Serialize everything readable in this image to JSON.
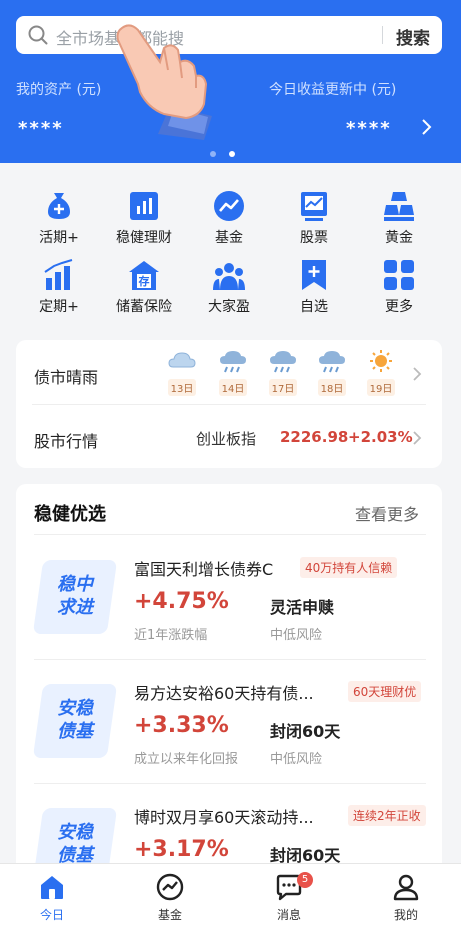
{
  "search": {
    "placeholder": "全市场基金都能搜",
    "button": "搜索"
  },
  "assets": {
    "my_assets_label": "我的资产 (元)",
    "my_assets_value": "****",
    "today_label": "今日收益更新中 (元)",
    "today_value": "****"
  },
  "grid": [
    {
      "label": "活期+",
      "icon": "money-bag-icon"
    },
    {
      "label": "稳健理财",
      "icon": "bar-chart-icon"
    },
    {
      "label": "基金",
      "icon": "trend-circle-icon"
    },
    {
      "label": "股票",
      "icon": "stock-board-icon"
    },
    {
      "label": "黄金",
      "icon": "gold-bars-icon"
    },
    {
      "label": "定期+",
      "icon": "growth-bars-icon"
    },
    {
      "label": "储蓄保险",
      "icon": "savings-house-icon"
    },
    {
      "label": "大家盈",
      "icon": "people-icon"
    },
    {
      "label": "自选",
      "icon": "bookmark-plus-icon"
    },
    {
      "label": "更多",
      "icon": "apps-icon"
    }
  ],
  "market": {
    "bond_title": "债市晴雨",
    "weather": [
      {
        "day": "13日",
        "icon": "cloud-icon"
      },
      {
        "day": "14日",
        "icon": "rain-icon"
      },
      {
        "day": "17日",
        "icon": "rain-icon"
      },
      {
        "day": "18日",
        "icon": "rain-icon"
      },
      {
        "day": "19日",
        "icon": "sun-icon"
      }
    ],
    "stock_title": "股市行情",
    "index_name": "创业板指",
    "index_value": "2226.98",
    "index_change": "+2.03%"
  },
  "products": {
    "title": "稳健优选",
    "more": "查看更多",
    "items": [
      {
        "badge1": "稳中",
        "badge2": "求进",
        "name": "富国天利增长债券C",
        "tag": "40万持有人信赖",
        "rate": "+4.75%",
        "rate_label": "近1年涨跌幅",
        "term": "灵活申赎",
        "risk": "中低风险"
      },
      {
        "badge1": "安稳",
        "badge2": "债基",
        "name": "易方达安裕60天持有债...",
        "tag": "60天理财优",
        "rate": "+3.33%",
        "rate_label": "成立以来年化回报",
        "term": "封闭60天",
        "risk": "中低风险"
      },
      {
        "badge1": "安稳",
        "badge2": "债基",
        "name": "博时双月享60天滚动持...",
        "tag": "连续2年正收",
        "rate": "+3.17%",
        "rate_label": "",
        "term": "封闭60天",
        "risk": ""
      }
    ]
  },
  "tabs": [
    {
      "label": "今日",
      "icon": "home-icon"
    },
    {
      "label": "基金",
      "icon": "fund-chart-icon"
    },
    {
      "label": "消息",
      "icon": "message-icon",
      "badge": "5"
    },
    {
      "label": "我的",
      "icon": "user-icon"
    }
  ],
  "colors": {
    "primary": "#2a6ff0",
    "red": "#d2453a",
    "background": "#f4f5f7"
  }
}
